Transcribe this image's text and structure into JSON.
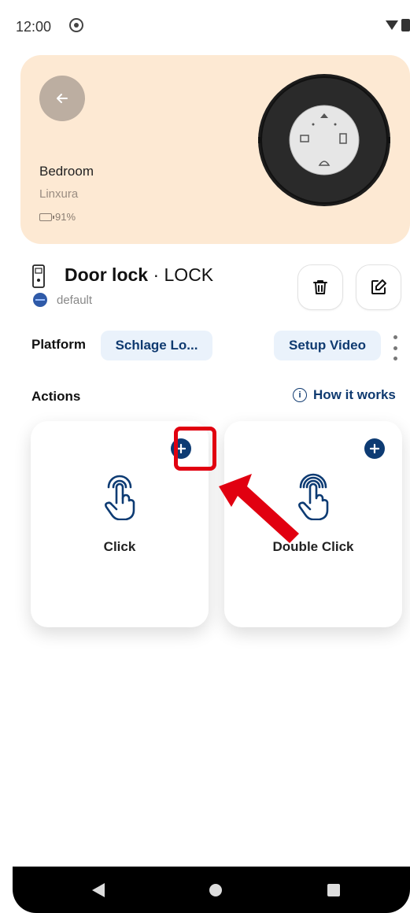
{
  "status_bar": {
    "time": "12:00"
  },
  "device": {
    "room": "Bedroom",
    "brand": "Linxura",
    "battery": "91%",
    "name": "Door lock",
    "type": "· LOCK",
    "space": "default",
    "accent_bg": "#fde9d3"
  },
  "platform": {
    "label": "Platform",
    "value": "Schlage Lo...",
    "setup_video": "Setup Video"
  },
  "actions": {
    "label": "Actions",
    "how_it_works": "How it works",
    "items": [
      {
        "label": "Click"
      },
      {
        "label": "Double Click"
      }
    ]
  },
  "colors": {
    "primary": "#0d3b73",
    "chip_bg": "#eaf2fb",
    "annotation": "#e10010"
  }
}
